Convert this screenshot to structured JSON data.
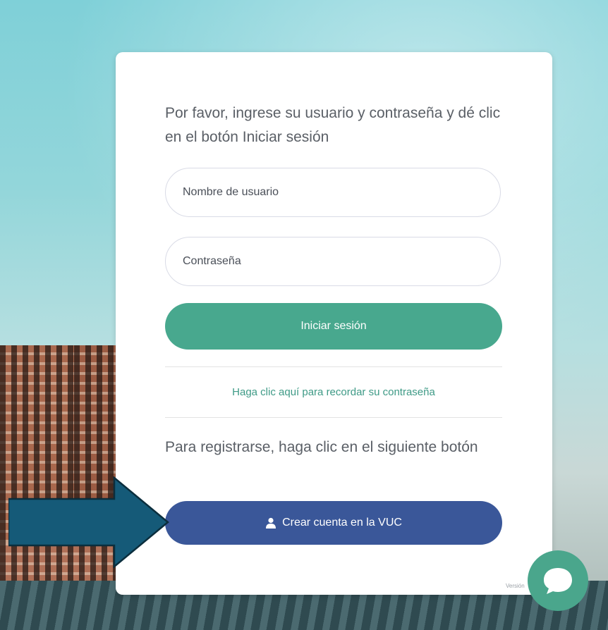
{
  "login": {
    "intro_text": "Por favor, ingrese su usuario y contraseña y dé clic en el botón Iniciar sesión",
    "username_placeholder": "Nombre de usuario",
    "username_value": "",
    "password_placeholder": "Contraseña",
    "password_value": "",
    "login_button_label": "Iniciar sesión",
    "forgot_password_link": "Haga clic aquí para recordar su contraseña",
    "register_text": "Para registrarse, haga clic en el siguiente botón",
    "create_account_label": "Crear cuenta en la VUC",
    "create_account_icon": "user-icon",
    "version_label": "Versión"
  },
  "chat": {
    "icon": "chat-bubble-icon"
  },
  "annotation": {
    "icon": "arrow-right-icon"
  },
  "colors": {
    "primary_green": "#48a88e",
    "link_green": "#3e9a86",
    "create_blue": "#3a5799",
    "arrow_fill": "#155a78",
    "text_gray": "#5a5f66"
  }
}
